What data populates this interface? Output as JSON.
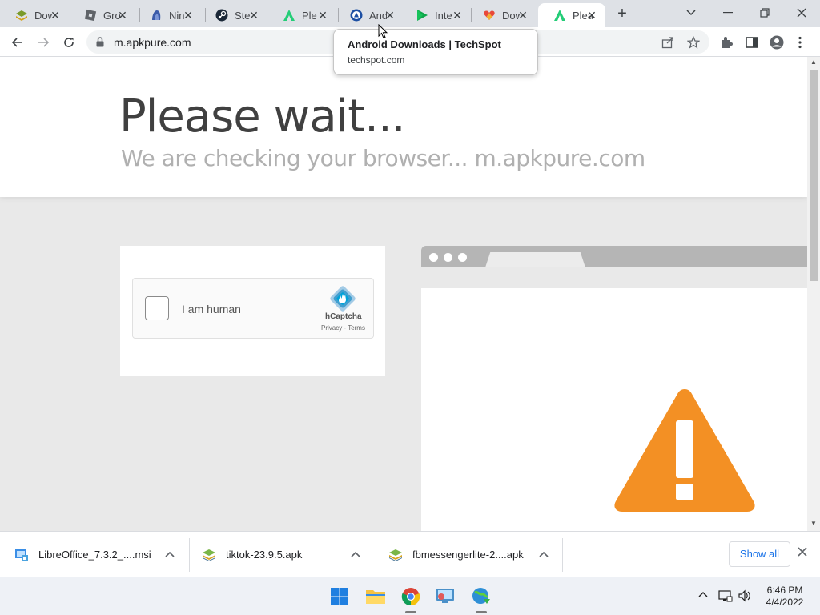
{
  "tabs": [
    {
      "title": "Dow",
      "favicon": "layers-icon",
      "active": false
    },
    {
      "title": "Gro",
      "favicon": "roblox-icon",
      "active": false
    },
    {
      "title": "Nin",
      "favicon": "ninite-icon",
      "active": false
    },
    {
      "title": "Ste",
      "favicon": "steam-icon",
      "active": false
    },
    {
      "title": "Ple",
      "favicon": "apkpure-icon",
      "active": false
    },
    {
      "title": "And",
      "favicon": "techspot-icon",
      "active": false
    },
    {
      "title": "Inte",
      "favicon": "play-icon",
      "active": false
    },
    {
      "title": "Dow",
      "favicon": "heart-icon",
      "active": false
    },
    {
      "title": "Plea",
      "favicon": "apkpure-icon",
      "active": true
    }
  ],
  "address_bar": {
    "url": "m.apkpure.com"
  },
  "tooltip": {
    "title": "Android Downloads | TechSpot",
    "domain": "techspot.com"
  },
  "page": {
    "heading": "Please wait...",
    "subheading": "We are checking your browser... m.apkpure.com",
    "captcha": {
      "label": "I am human",
      "brand": "hCaptcha",
      "links": "Privacy - Terms"
    }
  },
  "downloads": [
    {
      "name": "LibreOffice_7.3.2_....msi",
      "icon": "msi-installer-icon"
    },
    {
      "name": "tiktok-23.9.5.apk",
      "icon": "apk-package-icon"
    },
    {
      "name": "fbmessengerlite-2....apk",
      "icon": "apk-package-icon"
    }
  ],
  "shelf": {
    "show_all": "Show all"
  },
  "clock": {
    "time": "6:46 PM",
    "date": "4/4/2022"
  },
  "colors": {
    "warning": "#f39024",
    "accent": "#1a73e8",
    "tabstrip": "#dee1e6"
  }
}
